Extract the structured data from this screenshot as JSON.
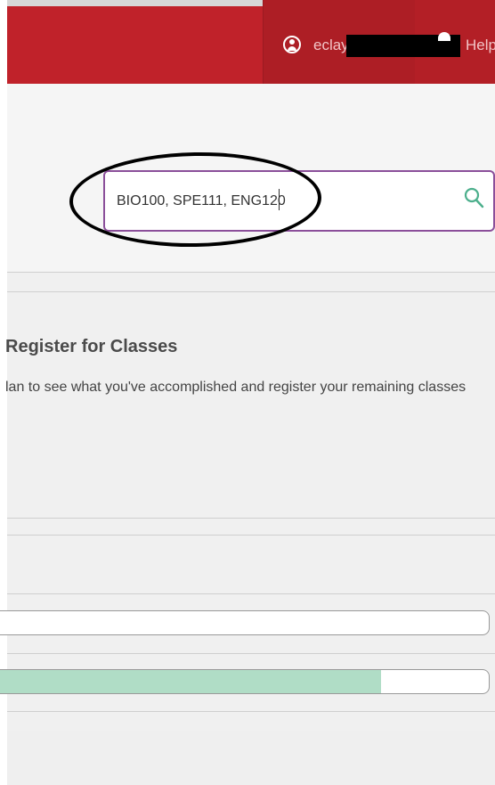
{
  "header": {
    "username": "eclay",
    "help_label": "Help",
    "user_icon": "user-circle-icon",
    "help_icon": "help-icon",
    "brand_color": "#c0222a"
  },
  "search": {
    "value": "BIO100, SPE111, ENG120",
    "icon": "search-icon",
    "border_color": "#8b4f9a"
  },
  "register": {
    "title": "Register for Classes",
    "description": "lan to see what you've accomplished and register your remaining classes"
  },
  "progress": [
    {
      "fraction": 0.0
    },
    {
      "fraction": 0.78,
      "color": "#b0ddc6"
    }
  ]
}
